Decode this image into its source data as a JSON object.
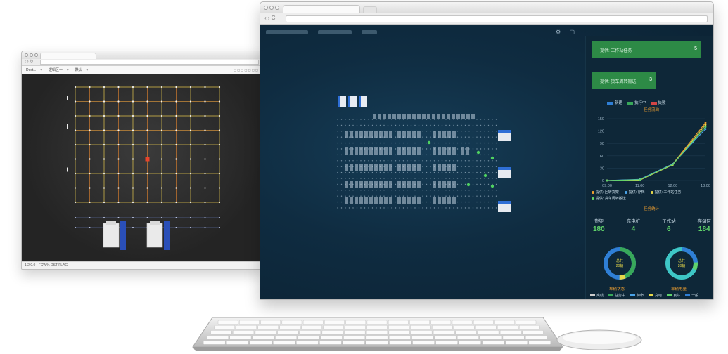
{
  "back_window": {
    "menu": [
      "Dest...",
      "逻辑区一",
      "默认"
    ],
    "status_text": "1.2.0.0   ·   FCW%  DST  FLAG"
  },
  "front_window": {
    "panel": {
      "buttons": [
        {
          "label": "提供: 工作站任务",
          "count": "5"
        },
        {
          "label": "提供: 货车周转搬送",
          "count": "3"
        }
      ],
      "legend_top": [
        {
          "name": "新建",
          "color": "#2f7fd6"
        },
        {
          "name": "执行中",
          "color": "#38a85a"
        },
        {
          "name": "失败",
          "color": "#d14545"
        }
      ],
      "chart1_title": "任务流向",
      "chart_yticks": [
        "150",
        "120",
        "90",
        "60",
        "30",
        "0"
      ],
      "chart_xticks": [
        "09:00",
        "11:00",
        "12:00",
        "13:00"
      ],
      "legend_lines": [
        {
          "name": "提供: 回转货架",
          "color": "#f0a030"
        },
        {
          "name": "提供: 存档",
          "color": "#4aa3e8"
        },
        {
          "name": "提供: 工作站任务",
          "color": "#e6d84a"
        },
        {
          "name": "提供: 货车周转搬送",
          "color": "#5fd36a"
        }
      ],
      "chart2_title": "任务统计",
      "stats": [
        {
          "label": "货架",
          "value": "180"
        },
        {
          "label": "充电桩",
          "value": "4"
        },
        {
          "label": "工作站",
          "value": "6"
        },
        {
          "label": "存储区",
          "value": "184"
        }
      ],
      "donut1": {
        "center_top": "总共",
        "center_bottom": "20辆",
        "caption": "车辆状态"
      },
      "donut2": {
        "center_top": "总共",
        "center_bottom": "20辆",
        "caption": "车辆电量"
      },
      "donut_legend": [
        {
          "name": "离线",
          "color": "#cccccc"
        },
        {
          "name": "任务中",
          "color": "#38a85a"
        },
        {
          "name": "待命",
          "color": "#4aa3e8"
        },
        {
          "name": "充电",
          "color": "#e6d84a"
        },
        {
          "name": "良好",
          "color": "#5fd36a"
        },
        {
          "name": "一般",
          "color": "#2f7fd6"
        },
        {
          "name": "休息",
          "color": "#f0a030"
        },
        {
          "name": "异常",
          "color": "#d14545"
        },
        {
          "name": "去充中",
          "color": "#3ec6c6"
        },
        {
          "name": "较充差",
          "color": "#e07b39"
        },
        {
          "name": "极低",
          "color": "#c0392b"
        }
      ]
    }
  },
  "chart_data": {
    "type": "line",
    "x": [
      "09:00",
      "11:00",
      "12:00",
      "13:00"
    ],
    "ylim": [
      0,
      150
    ],
    "series": [
      {
        "name": "提供: 回转货架",
        "values": [
          0,
          2,
          40,
          140
        ]
      },
      {
        "name": "提供: 存档",
        "values": [
          0,
          3,
          40,
          125
        ]
      },
      {
        "name": "提供: 工作站任务",
        "values": [
          0,
          1,
          38,
          135
        ]
      },
      {
        "name": "提供: 货车周转搬送",
        "values": [
          0,
          2,
          39,
          130
        ]
      }
    ]
  }
}
